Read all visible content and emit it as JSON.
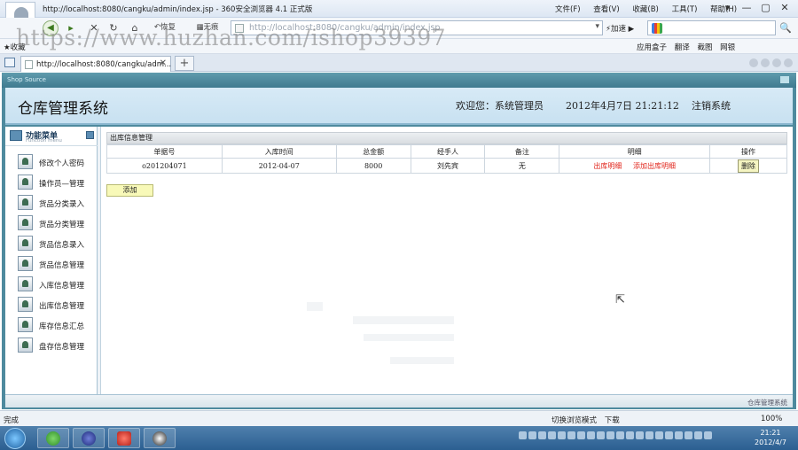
{
  "browser": {
    "title": "http://localhost:8080/cangku/admin/index.jsp - 360安全浏览器 4.1 正式版",
    "menus": [
      "文件(F)",
      "查看(V)",
      "收藏(B)",
      "工具(T)",
      "帮助(H)"
    ],
    "window_buttons": [
      "▾",
      "—",
      "▢",
      "✕"
    ],
    "nav": {
      "back": "◀",
      "forward": "▸",
      "stop": "✕",
      "refresh": "↻",
      "home": "⌂",
      "restore_label": "恢复",
      "trace_label": "无痕",
      "address": "http://localhost:8080/cangku/admin/index.jsp",
      "address_dropdown": "▾",
      "accelerate_label": "加速",
      "search_go": "🔍"
    },
    "favorites_label": "收藏",
    "favorites_right": [
      "应用盒子",
      "翻译",
      "截图",
      "网银"
    ],
    "tab": {
      "label": "http://localhost:8080/cangku/adm...",
      "close": "✕"
    },
    "new_tab": "+",
    "status_done": "完成",
    "status_items": [
      "切换浏览模式",
      "下载"
    ],
    "zoom": "100%"
  },
  "watermark": "https://www.huzhan.com/ishop39397",
  "app": {
    "frame_title": "Shop Source",
    "system_name": "仓库管理系统",
    "welcome": "欢迎您：系统管理员",
    "datetime": "2012年4月7日  21:21:12",
    "logout": "注销系统",
    "footer": "仓库管理系统"
  },
  "sidebar": {
    "title": "功能菜单",
    "subtitle": "Function menu",
    "items": [
      {
        "label": "修改个人密码"
      },
      {
        "label": "操作员—管理"
      },
      {
        "label": "货品分类录入"
      },
      {
        "label": "货品分类管理"
      },
      {
        "label": "货品信息录入"
      },
      {
        "label": "货品信息管理"
      },
      {
        "label": "入库信息管理"
      },
      {
        "label": "出库信息管理"
      },
      {
        "label": "库存信息汇总"
      },
      {
        "label": "盘存信息管理"
      }
    ]
  },
  "panel": {
    "title": "出库信息管理",
    "columns": [
      "单据号",
      "入库时间",
      "总金额",
      "经手人",
      "备注",
      "明细",
      "操作"
    ],
    "rows": [
      {
        "id": "o201204071",
        "date": "2012-04-07",
        "total": "8000",
        "handler": "刘先宾",
        "note": "无",
        "detail_link": "出库明细",
        "add_detail_link": "添加出库明细",
        "action": "删除"
      }
    ],
    "add_button": "添加"
  },
  "taskbar": {
    "clock_time": "21:21",
    "clock_date": "2012/4/7"
  }
}
